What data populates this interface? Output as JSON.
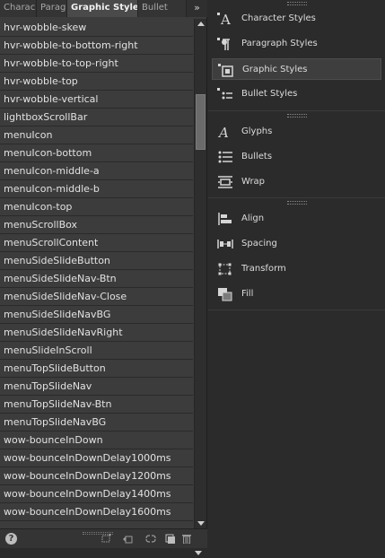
{
  "tabs": [
    {
      "label": "Charac",
      "active": false
    },
    {
      "label": "Paragı",
      "active": false
    },
    {
      "label": "Graphic Styles",
      "active": true
    },
    {
      "label": "Bullet",
      "active": false
    }
  ],
  "tab_overflow_glyph": "»",
  "list": {
    "items": [
      "hvr-wobble-skew",
      "hvr-wobble-to-bottom-right",
      "hvr-wobble-to-top-right",
      "hvr-wobble-top",
      "hvr-wobble-vertical",
      "lightboxScrollBar",
      "menuIcon",
      "menuIcon-bottom",
      "menuIcon-middle-a",
      "menuIcon-middle-b",
      "menuIcon-top",
      "menuScrollBox",
      "menuScrollContent",
      "menuSideSlideButton",
      "menuSideSlideNav-Btn",
      "menuSideSlideNav-Close",
      "menuSideSlideNavBG",
      "menuSideSlideNavRight",
      "menuSlideInScroll",
      "menuTopSlideButton",
      "menuTopSlideNav",
      "menuTopSlideNav-Btn",
      "menuTopSlideNavBG",
      "wow-bounceInDown",
      "wow-bounceInDownDelay1000ms",
      "wow-bounceInDownDelay1200ms",
      "wow-bounceInDownDelay1400ms",
      "wow-bounceInDownDelay1600ms"
    ],
    "scroll_fraction": 0.15
  },
  "bottom_bar": {
    "help_glyph": "?",
    "icons": [
      "new-style-icon",
      "clear-overrides-icon",
      "break-link-icon",
      "new-page-icon",
      "trash-icon"
    ]
  },
  "right_panel": {
    "groups": [
      {
        "items": [
          {
            "label": "Character Styles",
            "icon": "character-styles-icon",
            "active": false
          },
          {
            "label": "Paragraph Styles",
            "icon": "paragraph-styles-icon",
            "active": false
          },
          {
            "label": "Graphic Styles",
            "icon": "graphic-styles-icon",
            "active": true
          },
          {
            "label": "Bullet Styles",
            "icon": "bullet-styles-icon",
            "active": false
          }
        ]
      },
      {
        "items": [
          {
            "label": "Glyphs",
            "icon": "glyphs-icon",
            "active": false
          },
          {
            "label": "Bullets",
            "icon": "bullets-icon",
            "active": false
          },
          {
            "label": "Wrap",
            "icon": "wrap-icon",
            "active": false
          }
        ]
      },
      {
        "items": [
          {
            "label": "Align",
            "icon": "align-icon",
            "active": false
          },
          {
            "label": "Spacing",
            "icon": "spacing-icon",
            "active": false
          },
          {
            "label": "Transform",
            "icon": "transform-icon",
            "active": false
          },
          {
            "label": "Fill",
            "icon": "fill-icon",
            "active": false
          }
        ]
      }
    ]
  }
}
